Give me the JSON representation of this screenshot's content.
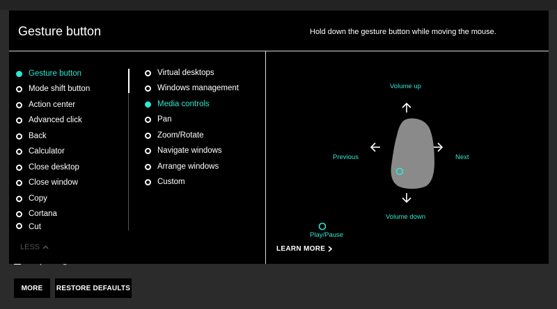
{
  "panel": {
    "title": "Gesture button",
    "hint": "Hold down the gesture button while moving the mouse."
  },
  "actions_col1": [
    {
      "label": "Gesture button",
      "selected": true
    },
    {
      "label": "Mode shift button",
      "selected": false
    },
    {
      "label": "Action center",
      "selected": false
    },
    {
      "label": "Advanced click",
      "selected": false
    },
    {
      "label": "Back",
      "selected": false
    },
    {
      "label": "Calculator",
      "selected": false
    },
    {
      "label": "Close desktop",
      "selected": false
    },
    {
      "label": "Close window",
      "selected": false
    },
    {
      "label": "Copy",
      "selected": false
    },
    {
      "label": "Cortana",
      "selected": false
    },
    {
      "label": "Cut",
      "selected": false
    }
  ],
  "actions_col2": [
    {
      "label": "Virtual desktops",
      "selected": false
    },
    {
      "label": "Windows management",
      "selected": false
    },
    {
      "label": "Media controls",
      "selected": true
    },
    {
      "label": "Pan",
      "selected": false
    },
    {
      "label": "Zoom/Rotate",
      "selected": false
    },
    {
      "label": "Navigate windows",
      "selected": false
    },
    {
      "label": "Arrange windows",
      "selected": false
    },
    {
      "label": "Custom",
      "selected": false
    }
  ],
  "less_label": "LESS",
  "learn_more_label": "LEARN MORE",
  "gestures": {
    "up": "Volume up",
    "down": "Volume down",
    "left": "Previous",
    "right": "Next",
    "click": "Play/Pause"
  },
  "swap_label": "Swap left/right buttons",
  "buttons": {
    "more": "MORE",
    "restore": "RESTORE DEFAULTS"
  },
  "colors": {
    "accent": "#2ee8d0",
    "panel_bg": "#000000",
    "page_bg": "#2b2b2b",
    "mouse": "#808080"
  }
}
